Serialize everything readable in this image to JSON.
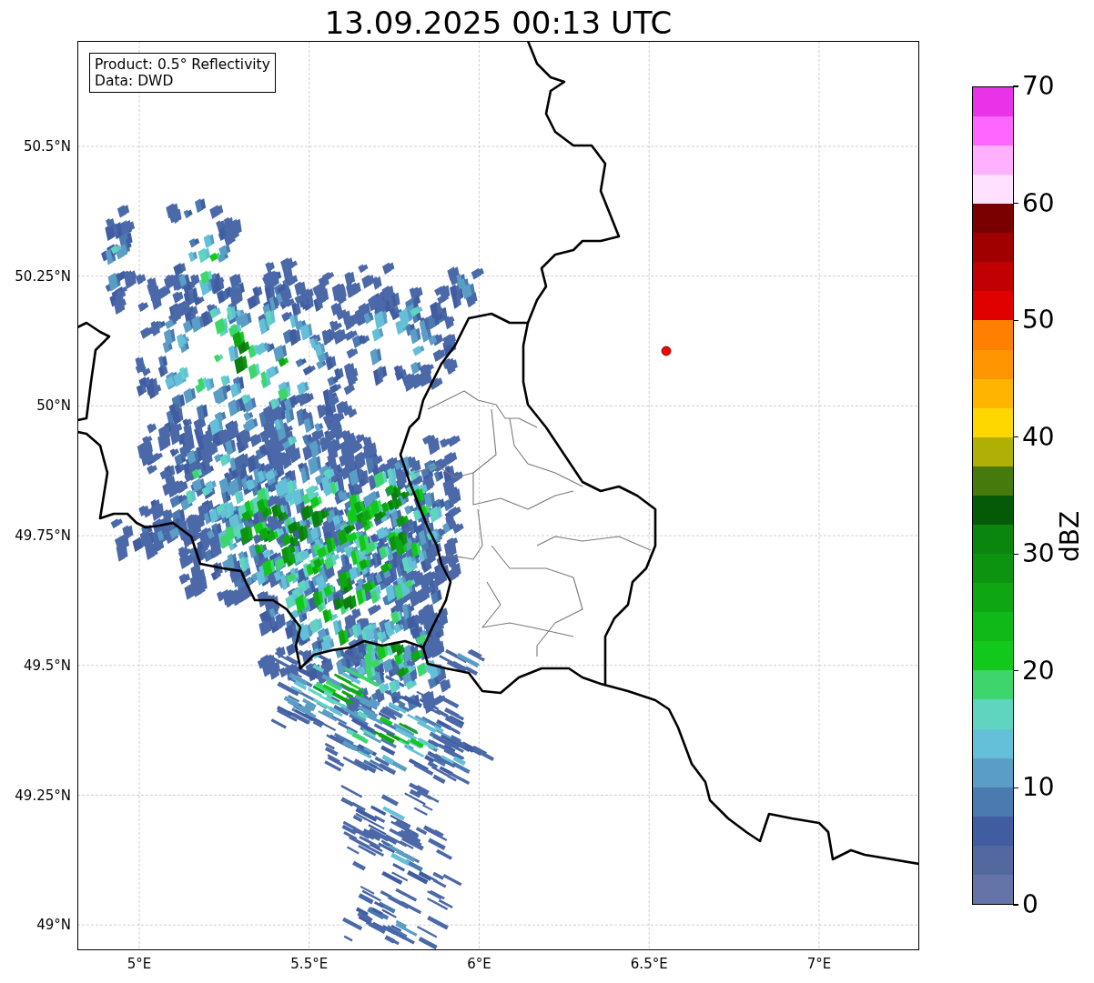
{
  "title": "13.09.2025 00:13 UTC",
  "info_box": {
    "lines": [
      "Product: 0.5° Reflectivity",
      "Data: DWD"
    ]
  },
  "map": {
    "x_ticks": [
      "5°E",
      "5.5°E",
      "6°E",
      "6.5°E",
      "7°E"
    ],
    "y_ticks": [
      "50.5°N",
      "50.25°N",
      "50°N",
      "49.75°N",
      "49.5°N",
      "49.25°N",
      "49°N"
    ]
  },
  "colorbar": {
    "label": "dBZ",
    "ticks": [
      "70",
      "60",
      "50",
      "40",
      "30",
      "20",
      "10",
      "0"
    ],
    "bands": [
      {
        "color": "#6473a8"
      },
      {
        "color": "#53689f"
      },
      {
        "color": "#3f5da0"
      },
      {
        "color": "#4b7ab0"
      },
      {
        "color": "#5a9dc5"
      },
      {
        "color": "#64c0d8"
      },
      {
        "color": "#5fd5c0"
      },
      {
        "color": "#3dd66c"
      },
      {
        "color": "#12c81a"
      },
      {
        "color": "#10b818"
      },
      {
        "color": "#0ea612"
      },
      {
        "color": "#0c9410"
      },
      {
        "color": "#0a850e"
      },
      {
        "color": "#055a08"
      },
      {
        "color": "#467a0c"
      },
      {
        "color": "#b0b004"
      },
      {
        "color": "#ffd700"
      },
      {
        "color": "#ffb400"
      },
      {
        "color": "#ff9500"
      },
      {
        "color": "#ff7f00"
      },
      {
        "color": "#e00000"
      },
      {
        "color": "#c00000"
      },
      {
        "color": "#a00000"
      },
      {
        "color": "#7a0000"
      },
      {
        "color": "#ffe0ff"
      },
      {
        "color": "#ffb0ff"
      },
      {
        "color": "#ff66ff"
      },
      {
        "color": "#e833e8"
      }
    ]
  }
}
